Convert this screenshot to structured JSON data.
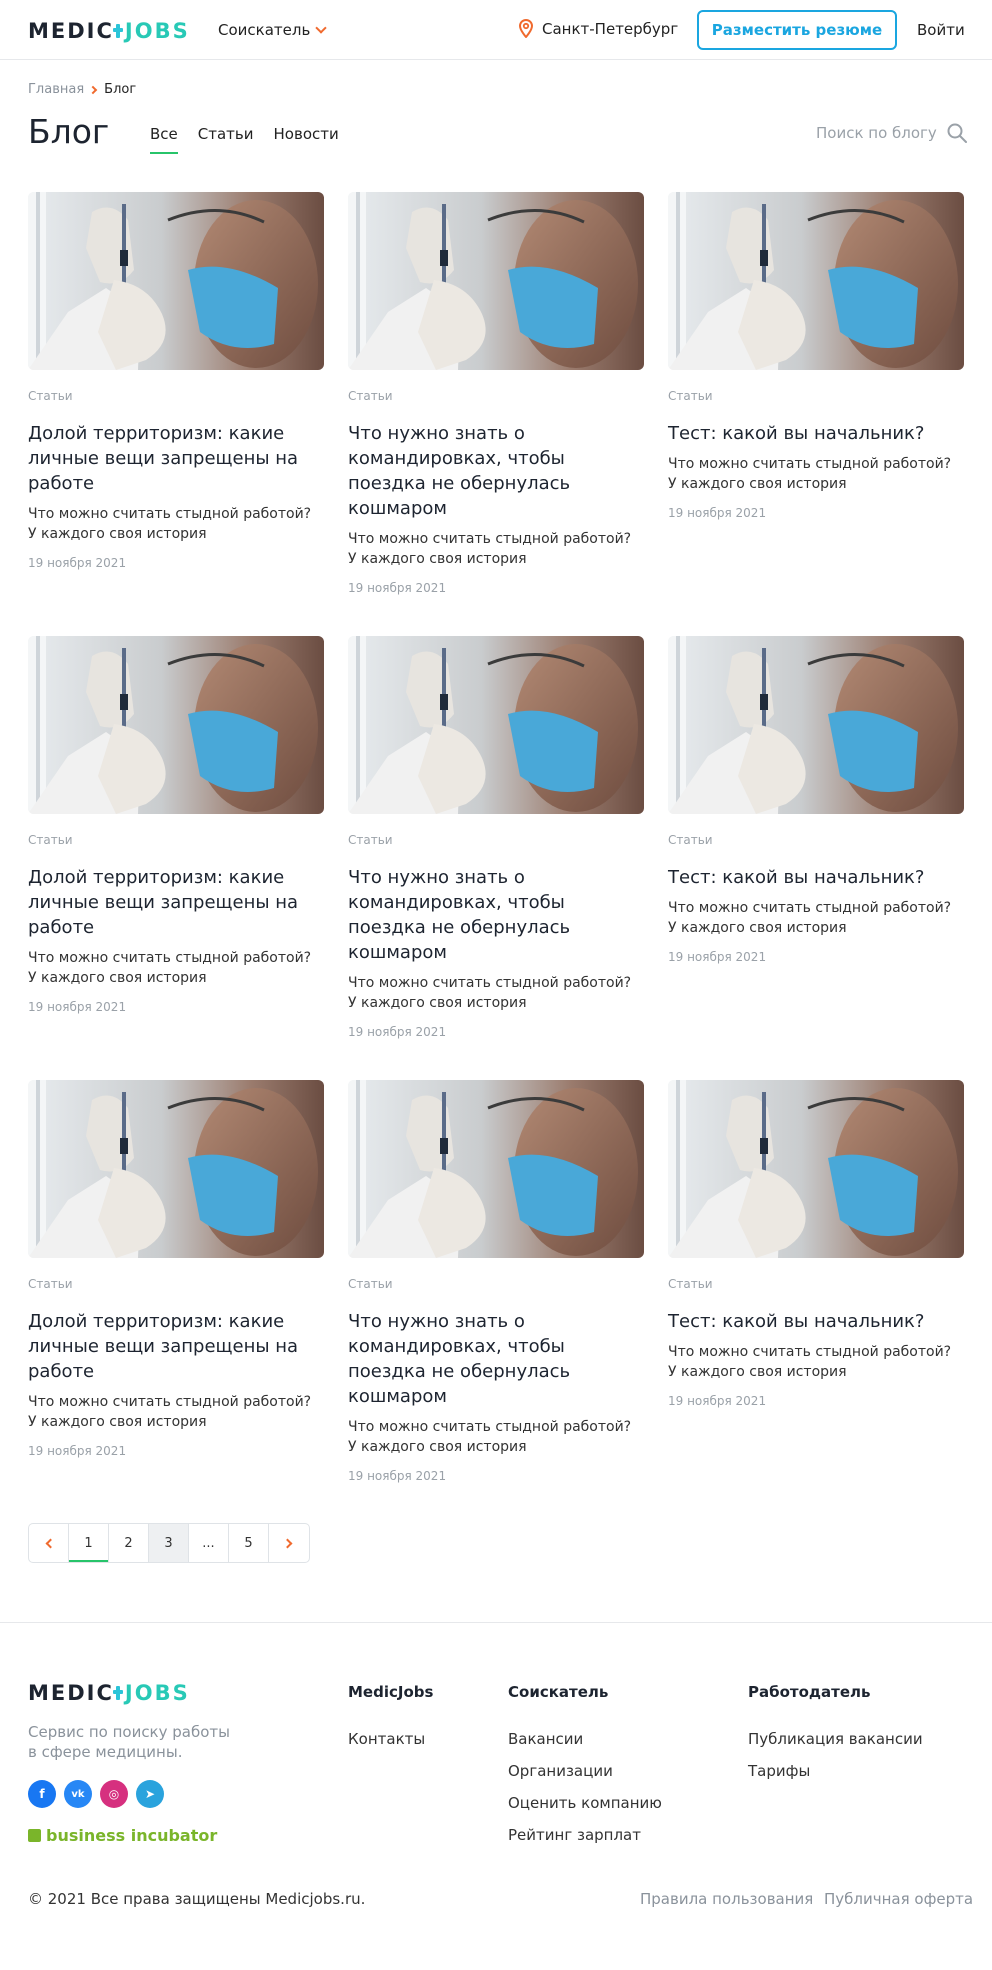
{
  "header": {
    "logo_part1": "MEDIC",
    "logo_part2": "JOBS",
    "role_label": "Соискатель",
    "city": "Санкт-Петербург",
    "post_resume": "Разместить резюме",
    "login": "Войти"
  },
  "breadcrumb": {
    "home": "Главная",
    "current": "Блог"
  },
  "page_title": "Блог",
  "tabs": [
    {
      "label": "Все",
      "active": true
    },
    {
      "label": "Статьи"
    },
    {
      "label": "Новости"
    }
  ],
  "search": {
    "placeholder": "Поиск по блогу"
  },
  "cards": [
    {
      "category": "Статьи",
      "title": "Долой территоризм: какие личные вещи запрещены на работе",
      "desc": "Что можно считать стыдной работой? У каждого своя история",
      "date": "19 ноября 2021"
    },
    {
      "category": "Статьи",
      "title": "Что нужно знать о командировках, чтобы поездка не обернулась кошмаром",
      "desc": "Что можно считать стыдной работой? У каждого своя история",
      "date": "19 ноября 2021"
    },
    {
      "category": "Статьи",
      "title": "Тест: какой вы начальник?",
      "desc": "Что можно считать стыдной работой? У каждого своя история",
      "date": "19 ноября 2021"
    },
    {
      "category": "Статьи",
      "title": "Долой территоризм: какие личные вещи запрещены на работе",
      "desc": "Что можно считать стыдной работой? У каждого своя история",
      "date": "19 ноября 2021"
    },
    {
      "category": "Статьи",
      "title": "Что нужно знать о командировках, чтобы поездка не обернулась кошмаром",
      "desc": "Что можно считать стыдной работой? У каждого своя история",
      "date": "19 ноября 2021"
    },
    {
      "category": "Статьи",
      "title": "Тест: какой вы начальник?",
      "desc": "Что можно считать стыдной работой? У каждого своя история",
      "date": "19 ноября 2021"
    },
    {
      "category": "Статьи",
      "title": "Долой территоризм: какие личные вещи запрещены на работе",
      "desc": "Что можно считать стыдной работой? У каждого своя история",
      "date": "19 ноября 2021"
    },
    {
      "category": "Статьи",
      "title": "Что нужно знать о командировках, чтобы поездка не обернулась кошмаром",
      "desc": "Что можно считать стыдной работой? У каждого своя история",
      "date": "19 ноября 2021"
    },
    {
      "category": "Статьи",
      "title": "Тест: какой вы начальник?",
      "desc": "Что можно считать стыдной работой? У каждого своя история",
      "date": "19 ноября 2021"
    }
  ],
  "pagination": [
    "1",
    "2",
    "3",
    "...",
    "5"
  ],
  "footer": {
    "tagline": "Сервис по поиску работы в сфере медицины.",
    "socials": [
      {
        "icon": "facebook-icon",
        "glyph": "f",
        "color": "#1877f2"
      },
      {
        "icon": "vk-icon",
        "glyph": "vk",
        "color": "#2787f5"
      },
      {
        "icon": "instagram-icon",
        "glyph": "◎",
        "color": "#d6307f"
      },
      {
        "icon": "telegram-icon",
        "glyph": "➤",
        "color": "#2aa3dd"
      }
    ],
    "incubator": "business incubator",
    "col1": {
      "title": "MedicJobs",
      "links": [
        "Контакты"
      ]
    },
    "col2": {
      "title": "Соискатель",
      "links": [
        "Вакансии",
        "Организации",
        "Оценить компанию",
        "Рейтинг зарплат"
      ]
    },
    "col3": {
      "title": "Работодатель",
      "links": [
        "Публикация вакансии",
        "Тарифы"
      ]
    },
    "copyright": "© 2021 Все права защищены Medicjobs.ru.",
    "terms": "Правила пользования",
    "offer": "Публичная оферта"
  },
  "colors": {
    "accent_blue": "#1aa6e0",
    "accent_green": "#27c46a",
    "accent_orange": "#f06a2e",
    "logo_teal": "#28c9b6"
  }
}
